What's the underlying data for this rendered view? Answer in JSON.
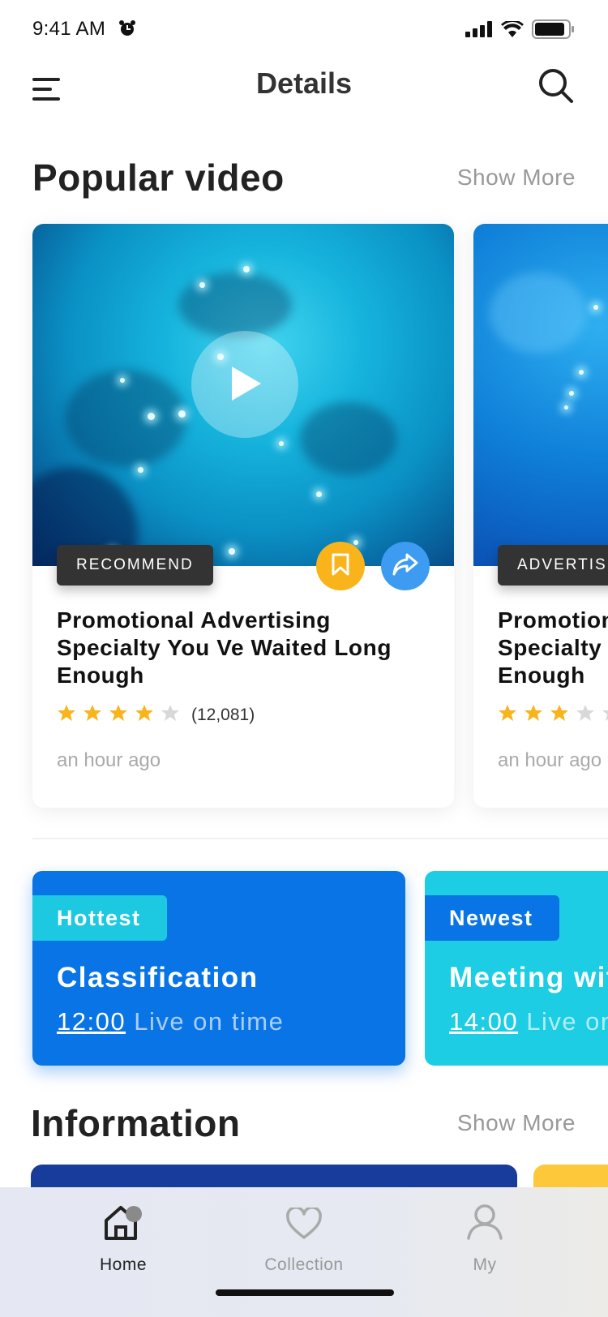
{
  "status_bar": {
    "time": "9:41 AM"
  },
  "nav": {
    "title": "Details"
  },
  "popular": {
    "title": "Popular video",
    "show_more": "Show More"
  },
  "videos": [
    {
      "tag": "RECOMMEND",
      "title": "Promotional Advertising Specialty You Ve Waited Long Enough",
      "rating": 4,
      "rating_count": "(12,081)",
      "time_ago": "an hour ago"
    },
    {
      "tag": "ADVERTISING",
      "title": "Promotional Advertising Specialty You Ve Waited Long Enough",
      "rating": 3,
      "time_ago": "an hour ago"
    }
  ],
  "live": [
    {
      "badge": "Hottest",
      "name": "Classification",
      "time": "12:00",
      "label": "Live on time"
    },
    {
      "badge": "Newest",
      "name": "Meeting with",
      "time": "14:00",
      "label": "Live on time"
    }
  ],
  "information": {
    "title": "Information",
    "show_more": "Show More"
  },
  "tabs": [
    {
      "label": "Home",
      "active": true
    },
    {
      "label": "Collection",
      "active": false
    },
    {
      "label": "My",
      "active": false
    }
  ],
  "colors": {
    "accent_blue": "#0874e6",
    "accent_cyan": "#1ccde3",
    "bookmark": "#f9b41b",
    "share": "#3d9bf1",
    "star": "#f9b41b"
  }
}
